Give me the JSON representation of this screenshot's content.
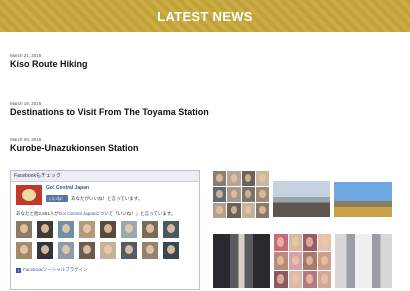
{
  "banner": {
    "title": "LATEST NEWS"
  },
  "news": [
    {
      "date": "March 21, 2015",
      "title": "Kiso Route Hiking"
    },
    {
      "date": "March 19, 2015",
      "title": "Destinations to Visit From The Toyama Station"
    },
    {
      "date": "March 09, 2015",
      "title": "Kurobe-Unazukionsen Station"
    }
  ],
  "facebook": {
    "header": "Facebookもチェック",
    "page_name": "Go! Central Japan",
    "like_button": "いいね！",
    "like_text": "あなたがいいね！と言っています。",
    "count_prefix": "あなたと他2,661人が",
    "count_link": "Go! Central Japan",
    "count_suffix": "について「いいね！」と言っています。",
    "footer": "Facebookソーシャルプラグイン",
    "footer_icon": "f"
  },
  "colors": {
    "banner": "#c9a93a",
    "facebook_blue": "#3b5998"
  }
}
